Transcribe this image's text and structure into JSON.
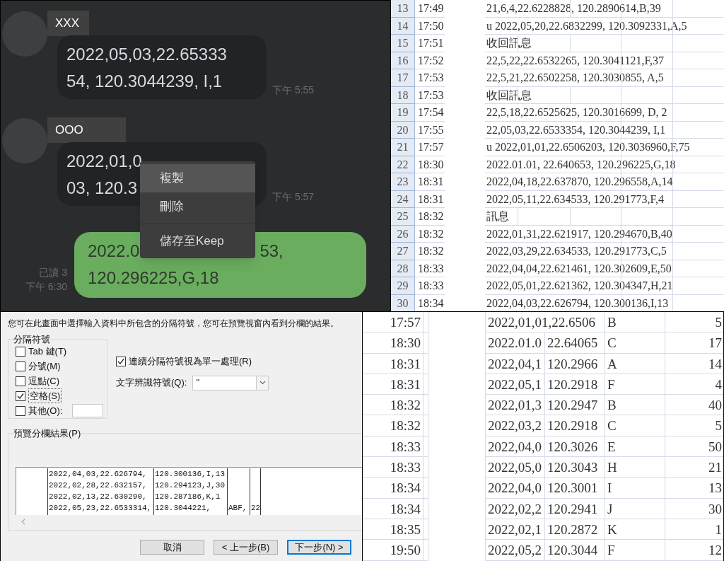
{
  "chat": {
    "messages": [
      {
        "kind": "incoming",
        "sender": "XXX",
        "lines": [
          [
            "2022,05,03,22.65333"
          ],
          [
            "54, 120.3044239, I,1"
          ]
        ],
        "time": "下午 5:55"
      },
      {
        "kind": "incoming",
        "sender": "OOO",
        "lines": [
          [
            "2022,01,0"
          ],
          [
            "03, 120.3"
          ]
        ],
        "time": "下午 5:57"
      },
      {
        "kind": "outgoing",
        "lines": [
          [
            "2022.0",
            "53,"
          ],
          [
            "120.296225,G,18"
          ]
        ],
        "read": "已讀 3",
        "time": "下午 6:30"
      }
    ],
    "context_menu": {
      "items": [
        {
          "label": "複製",
          "selected": true
        },
        {
          "label": "刪除",
          "selected": false
        },
        {
          "label": "儲存至Keep",
          "selected": false
        }
      ]
    }
  },
  "sheet_top": {
    "rows": [
      {
        "row": "13",
        "time": "17:49",
        "text": "21,6,4,22.6228828, 120.2890614,B,39"
      },
      {
        "row": "14",
        "time": "17:50",
        "text": "u 2022,05,20,22.6832299, 120.3092331,A,5"
      },
      {
        "row": "15",
        "time": "17:51",
        "text": "收回訊息"
      },
      {
        "row": "16",
        "time": "17:52",
        "text": "22,5,22,22.6532265, 120.3041121,F,37"
      },
      {
        "row": "17",
        "time": "17:53",
        "text": "22,5,21,22.6502258, 120.3030855, A,5"
      },
      {
        "row": "18",
        "time": "17:53",
        "text": "收回訊息"
      },
      {
        "row": "19",
        "time": "17:54",
        "text": "22,5,18,22.6525625, 120.3016699, D, 2"
      },
      {
        "row": "20",
        "time": "17:55",
        "text": "22,05,03,22.6533354, 120.3044239, I,1"
      },
      {
        "row": "21",
        "time": "17:57",
        "text": "u 2022,01,01,22.6506203, 120.3036960,F,75"
      },
      {
        "row": "22",
        "time": "18:30",
        "text": "2022.01.01, 22.640653, 120.296225,G,18"
      },
      {
        "row": "23",
        "time": "18:31",
        "text": "2022,04,18,22.637870, 120.296558,A,14"
      },
      {
        "row": "24",
        "time": "18:31",
        "text": "2022,05,11,22.634533, 120.291773,F,4"
      },
      {
        "row": "25",
        "time": "18:32",
        "text": "訊息"
      },
      {
        "row": "26",
        "time": "18:32",
        "text": "2022,01,31,22.621917, 120.294670,B,40"
      },
      {
        "row": "27",
        "time": "18:32",
        "text": "2022,03,29,22.634533, 120.291773,C,5"
      },
      {
        "row": "28",
        "time": "18:33",
        "text": "2022,04,04,22.621461, 120.302609,E,50"
      },
      {
        "row": "29",
        "time": "18:33",
        "text": "2022,05,01,22.621362, 120.304347,H,21"
      },
      {
        "row": "30",
        "time": "18:34",
        "text": "2022,04,03,22.626794, 120.300136,I,13"
      }
    ]
  },
  "dialog": {
    "instruction": "您可在此畫面中選擇輸入資料中所包含的分隔符號，您可在預覽視窗內看到分欄的結果。",
    "delimiters_title": "分隔符號",
    "delimiters": [
      {
        "label": "Tab 鍵(T)",
        "checked": false
      },
      {
        "label": "分號(M)",
        "checked": false
      },
      {
        "label": "逗點(C)",
        "checked": false
      },
      {
        "label": "空格(S)",
        "checked": true
      },
      {
        "label": "其他(O):",
        "checked": false,
        "kind": "other"
      }
    ],
    "consecutive": {
      "label": "連續分隔符號視為單一處理(R)",
      "checked": true
    },
    "qualifier": {
      "label": "文字辨識符號(Q):",
      "value": "\""
    },
    "preview_title": "預覽分欄結果(P)",
    "preview_rows": [
      [
        "2022,04,03,22.626794,",
        "120.300136,I,13"
      ],
      [
        "2022,02,28,22.632157,",
        "120.294123,J,30"
      ],
      [
        "2022,02,13,22.630290,",
        "120.287186,K,1"
      ],
      [
        "2022,05,23,22.6533314,",
        "120.3044221,",
        "ABF,",
        "22"
      ]
    ],
    "buttons": [
      {
        "label": "取消",
        "selected": false
      },
      {
        "label": "< 上一步(B)",
        "selected": false
      },
      {
        "label": "下一步(N) >",
        "selected": true
      }
    ]
  },
  "sheet_bottom": {
    "rows": [
      {
        "time": "17:57",
        "column_c": "2022,01,01,22.6506",
        "column_e": "B",
        "column_f": "5"
      },
      {
        "time": "18:30",
        "column_c": "2022.01.0",
        "column_d": "22.64065",
        "column_e": "C",
        "column_f": "17"
      },
      {
        "time": "18:31",
        "column_c": "2022,04,1",
        "column_d": "120.2966",
        "column_e": "A",
        "column_f": "14"
      },
      {
        "time": "18:31",
        "column_c": "2022,05,1",
        "column_d": "120.2918",
        "column_e": "F",
        "column_f": "4"
      },
      {
        "time": "18:32",
        "column_c": "2022,01,3",
        "column_d": "120.2947",
        "column_e": "B",
        "column_f": "40"
      },
      {
        "time": "18:32",
        "column_c": "2022,03,2",
        "column_d": "120.2918",
        "column_e": "C",
        "column_f": "5"
      },
      {
        "time": "18:33",
        "column_c": "2022,04,0",
        "column_d": "120.3026",
        "column_e": "E",
        "column_f": "50"
      },
      {
        "time": "18:33",
        "column_c": "2022,05,0",
        "column_d": "120.3043",
        "column_e": "H",
        "column_f": "21"
      },
      {
        "time": "18:34",
        "column_c": "2022,04,0",
        "column_d": "120.3001",
        "column_e": "I",
        "column_f": "13"
      },
      {
        "time": "18:34",
        "column_c": "2022,02,2",
        "column_d": "120.2941",
        "column_e": "J",
        "column_f": "30"
      },
      {
        "time": "18:35",
        "column_c": "2022,02,1",
        "column_d": "120.2872",
        "column_e": "K",
        "column_f": "1"
      },
      {
        "time": "19:50",
        "column_c": "2022,05,2",
        "column_d": "120.3044",
        "column_e": "F",
        "column_f": "12"
      }
    ]
  }
}
